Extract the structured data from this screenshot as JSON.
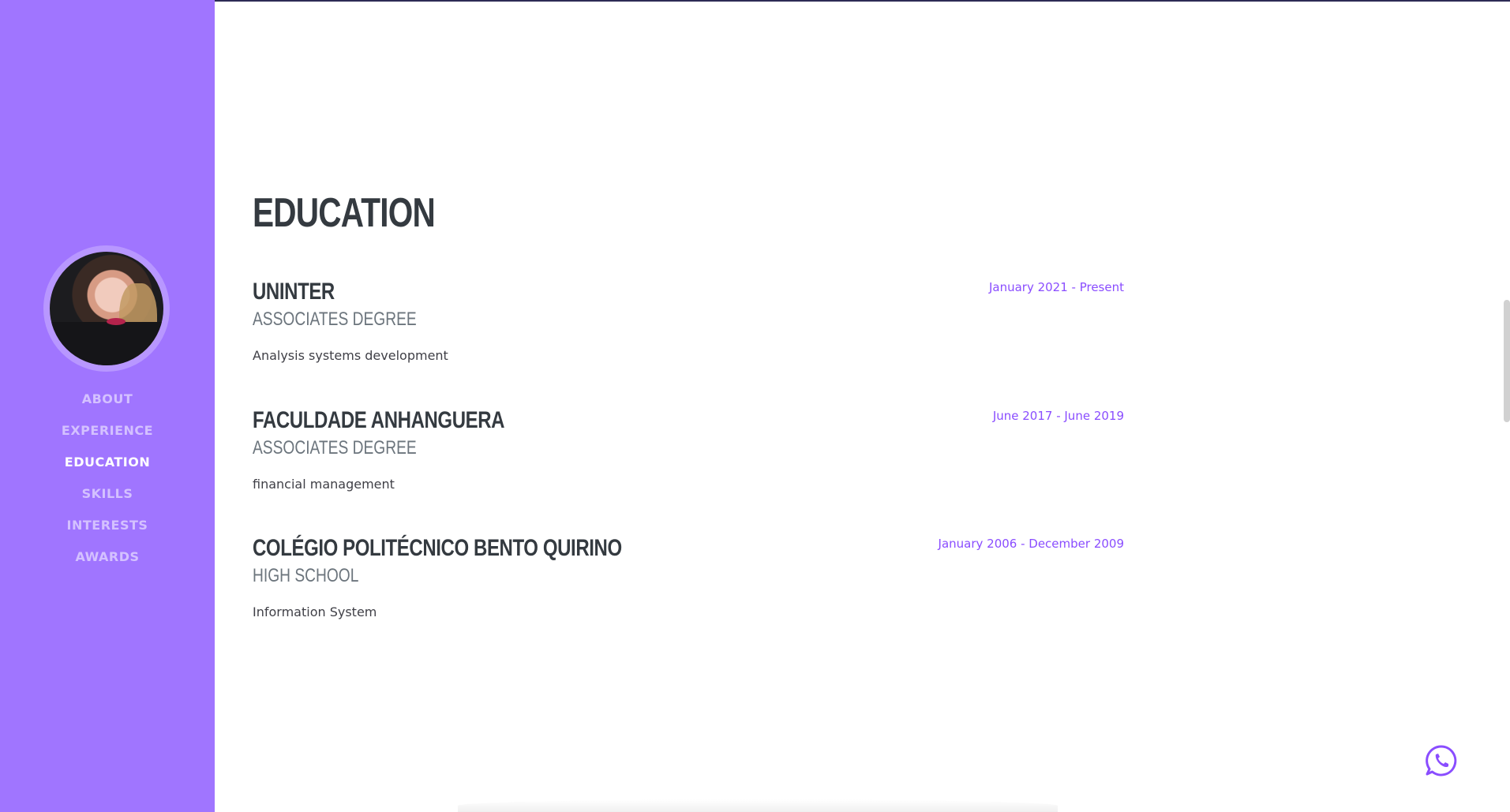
{
  "sidebar": {
    "nav": [
      {
        "label": "ABOUT",
        "active": false
      },
      {
        "label": "EXPERIENCE",
        "active": false
      },
      {
        "label": "EDUCATION",
        "active": true
      },
      {
        "label": "SKILLS",
        "active": false
      },
      {
        "label": "INTERESTS",
        "active": false
      },
      {
        "label": "AWARDS",
        "active": false
      }
    ],
    "background_color": "#a075ff"
  },
  "main": {
    "section_title": "EDUCATION",
    "education": [
      {
        "school": "UNINTER",
        "degree": "ASSOCIATES DEGREE",
        "field": "Analysis systems development",
        "dates": "January 2021 - Present"
      },
      {
        "school": "FACULDADE ANHANGUERA",
        "degree": "ASSOCIATES DEGREE",
        "field": "financial management",
        "dates": "June 2017 - June 2019"
      },
      {
        "school": "COLÉGIO POLITÉCNICO BENTO QUIRINO",
        "degree": "HIGH SCHOOL",
        "field": "Information System",
        "dates": "January 2006 - December 2009"
      }
    ]
  },
  "floating": {
    "icon": "whatsapp-icon"
  },
  "colors": {
    "accent": "#8a4dff",
    "heading": "#343a40"
  }
}
